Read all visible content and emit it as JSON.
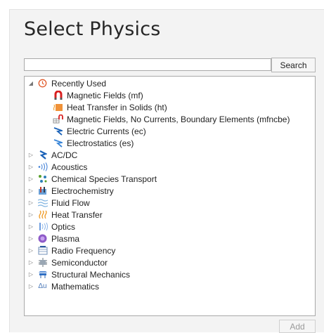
{
  "title": "Select Physics",
  "search": {
    "value": "",
    "button_label": "Search"
  },
  "tree": {
    "recent": {
      "label": "Recently Used",
      "items": [
        {
          "label": "Magnetic Fields (mf)",
          "icon": "magnet-icon"
        },
        {
          "label": "Heat Transfer in Solids (ht)",
          "icon": "heat-solid-icon"
        },
        {
          "label": "Magnetic Fields, No Currents, Boundary Elements (mfncbe)",
          "icon": "magnet-bem-icon"
        },
        {
          "label": "Electric Currents (ec)",
          "icon": "electric-currents-icon"
        },
        {
          "label": "Electrostatics (es)",
          "icon": "electrostatics-icon"
        }
      ]
    },
    "categories": [
      {
        "label": "AC/DC",
        "icon": "acdc-icon"
      },
      {
        "label": "Acoustics",
        "icon": "acoustics-icon"
      },
      {
        "label": "Chemical Species Transport",
        "icon": "chemical-transport-icon"
      },
      {
        "label": "Electrochemistry",
        "icon": "electrochemistry-icon"
      },
      {
        "label": "Fluid Flow",
        "icon": "fluid-flow-icon"
      },
      {
        "label": "Heat Transfer",
        "icon": "heat-transfer-icon"
      },
      {
        "label": "Optics",
        "icon": "optics-icon"
      },
      {
        "label": "Plasma",
        "icon": "plasma-icon"
      },
      {
        "label": "Radio Frequency",
        "icon": "radio-frequency-icon"
      },
      {
        "label": "Semiconductor",
        "icon": "semiconductor-icon"
      },
      {
        "label": "Structural Mechanics",
        "icon": "structural-mechanics-icon"
      },
      {
        "label": "Mathematics",
        "icon": "mathematics-icon"
      }
    ]
  },
  "add_label": "Add"
}
